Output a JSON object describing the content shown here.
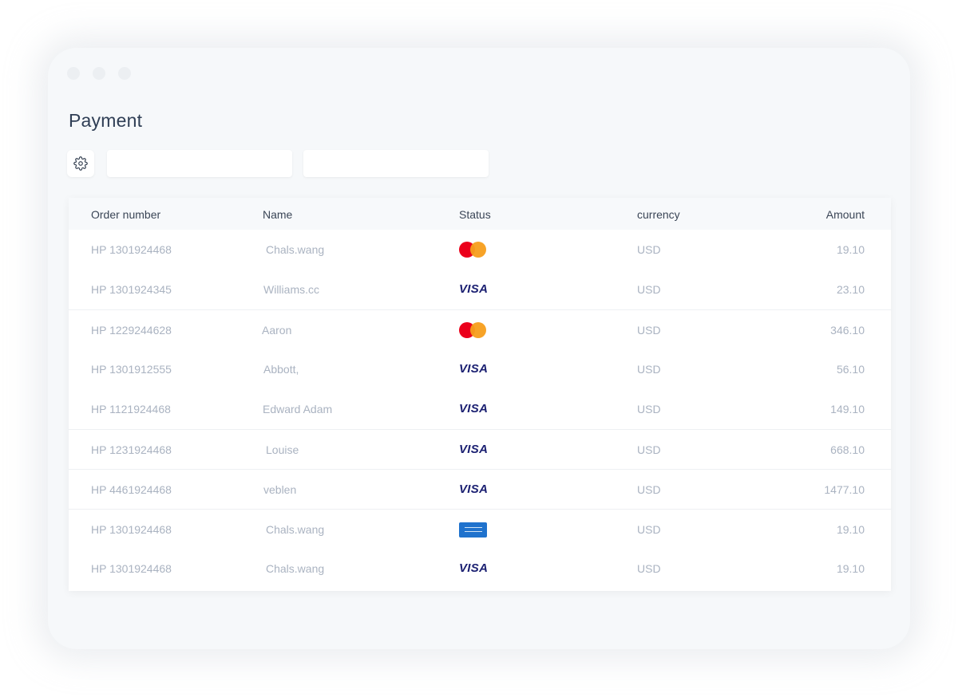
{
  "page": {
    "title": "Payment"
  },
  "toolbar": {
    "settings_icon": "gear-icon",
    "filter_1": {
      "value": "",
      "placeholder": ""
    },
    "filter_2": {
      "value": "",
      "placeholder": ""
    }
  },
  "table": {
    "columns": [
      "Order number",
      "Name",
      "Status",
      "currency",
      "Amount"
    ],
    "rows": [
      {
        "order": "HP 1301924468",
        "name": "Chals.wang",
        "card": "mastercard",
        "currency": "USD",
        "amount": "19.10"
      },
      {
        "order": "HP 1301924345",
        "name": "Williams.cc",
        "card": "visa",
        "currency": "USD",
        "amount": "23.10"
      },
      {
        "order": "HP 1229244628",
        "name": "Aaron",
        "card": "mastercard",
        "currency": "USD",
        "amount": "346.10"
      },
      {
        "order": "HP 1301912555",
        "name": "Abbott,",
        "card": "visa",
        "currency": "USD",
        "amount": "56.10"
      },
      {
        "order": "HP 1121924468",
        "name": "Edward Adam",
        "card": "visa",
        "currency": "USD",
        "amount": "149.10"
      },
      {
        "order": "HP 1231924468",
        "name": "Louise",
        "card": "visa",
        "currency": "USD",
        "amount": "668.10"
      },
      {
        "order": "HP 4461924468",
        "name": "veblen",
        "card": "visa",
        "currency": "USD",
        "amount": "1477.10"
      },
      {
        "order": "HP 1301924468",
        "name": "Chals.wang",
        "card": "amex",
        "currency": "USD",
        "amount": "19.10"
      },
      {
        "order": "HP 1301924468",
        "name": "Chals.wang",
        "card": "visa",
        "currency": "USD",
        "amount": "19.10"
      }
    ],
    "visa_label": "VISA"
  },
  "colors": {
    "window_bg": "#f6f8fa",
    "title": "#2f3e55",
    "header_text": "#3a4556",
    "cell_text": "#aab3c1",
    "visa": "#1a1f71",
    "mastercard_red": "#eb001b",
    "mastercard_orange": "#f79e1b",
    "amex": "#1f72cd"
  }
}
